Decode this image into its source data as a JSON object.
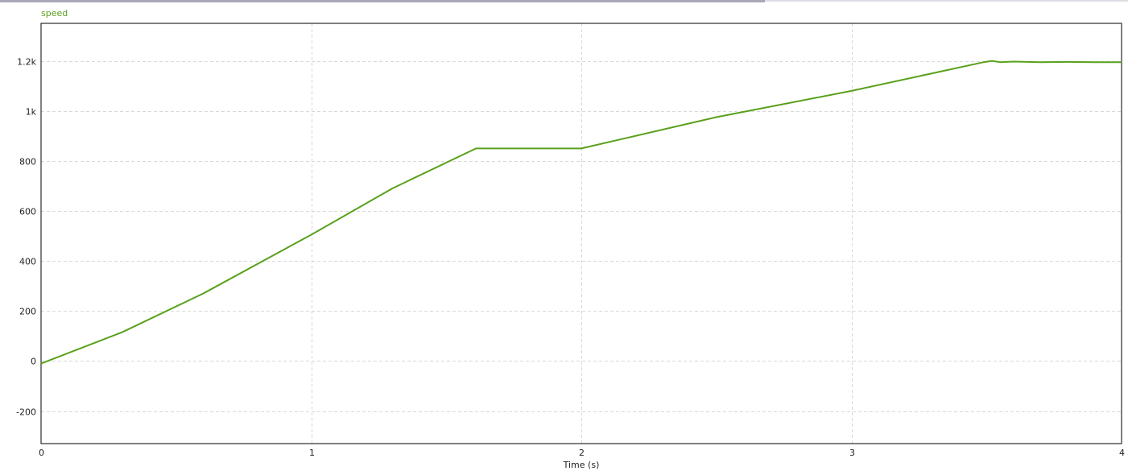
{
  "chart_data": {
    "type": "line",
    "title": "",
    "xlabel": "Time (s)",
    "ylabel": "",
    "xlim": [
      0,
      4
    ],
    "ylim": [
      -330,
      1350
    ],
    "x_ticks": [
      0,
      1,
      2,
      3,
      4
    ],
    "x_tick_labels": [
      "0",
      "1",
      "2",
      "3",
      "4"
    ],
    "y_ticks": [
      -200,
      0,
      200,
      400,
      600,
      800,
      1000,
      1200
    ],
    "y_tick_labels": [
      "-200",
      "0",
      "200",
      "400",
      "600",
      "800",
      "1k",
      "1.2k"
    ],
    "grid": true,
    "legend_position": "top-left",
    "series": [
      {
        "name": "speed",
        "color": "#5aa01c",
        "x": [
          0,
          0.3,
          0.6,
          1.0,
          1.3,
          1.61,
          1.7,
          2.0,
          2.5,
          3.0,
          3.49,
          3.52,
          3.55,
          3.6,
          3.7,
          3.8,
          3.9,
          4.0
        ],
        "y": [
          -10,
          115,
          270,
          505,
          690,
          850,
          850,
          850,
          975,
          1080,
          1195,
          1200,
          1195,
          1197,
          1195,
          1196,
          1195,
          1195
        ]
      }
    ]
  }
}
